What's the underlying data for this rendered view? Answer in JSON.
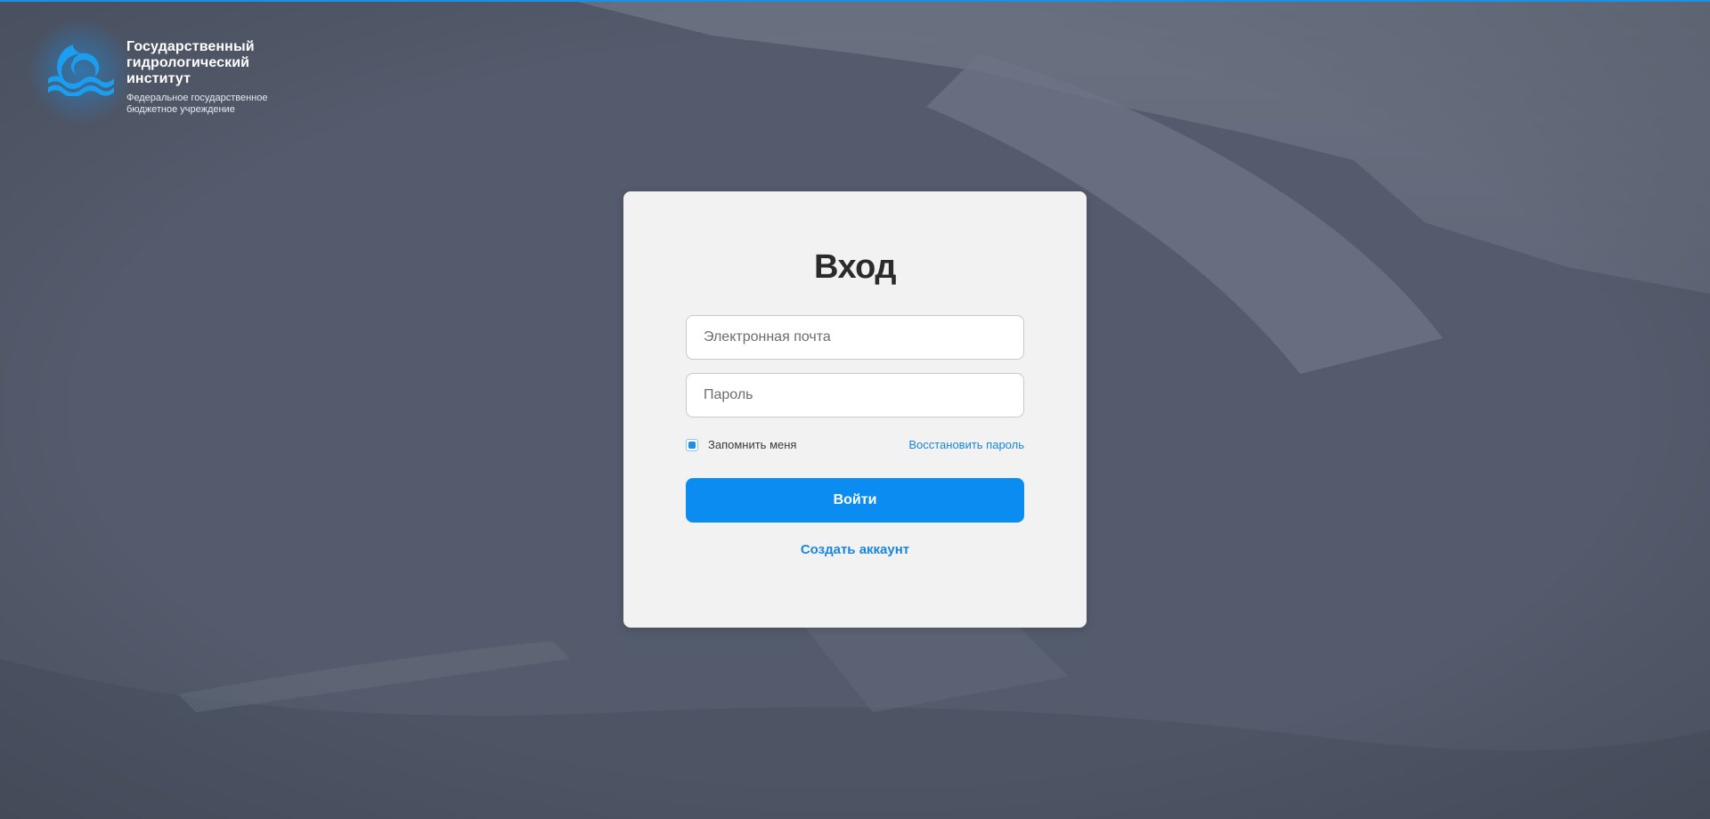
{
  "brand": {
    "title": "Государственный\nгидрологический\nинститут",
    "subtitle": "Федеральное государственное\nбюджетное учреждение",
    "logo_icon": "wave-logo-icon"
  },
  "login": {
    "title": "Вход",
    "email_placeholder": "Электронная почта",
    "email_value": "",
    "password_placeholder": "Пароль",
    "password_value": "",
    "remember_label": "Запомнить меня",
    "remember_checked": true,
    "restore_link": "Восстановить пароль",
    "submit_label": "Войти",
    "create_account_link": "Создать аккаунт"
  },
  "colors": {
    "accent": "#0a8cf0",
    "link": "#1a86dc",
    "overlay": "#525a6b",
    "card": "#f2f2f2"
  }
}
